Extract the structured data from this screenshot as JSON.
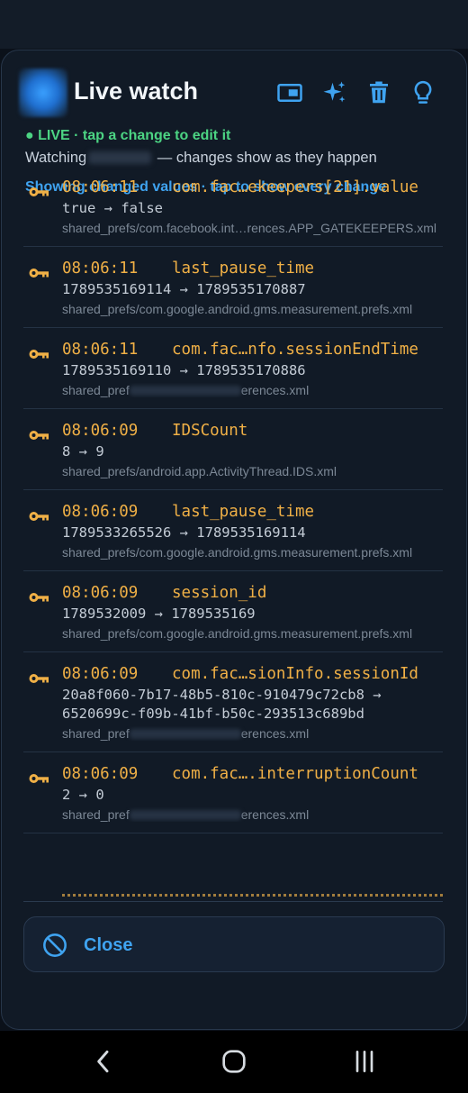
{
  "header": {
    "title": "Live watch",
    "icons": [
      "picture-in-picture-icon",
      "sparkles-icon",
      "trash-icon",
      "lightbulb-icon"
    ]
  },
  "status": "● LIVE · tap a change to edit it",
  "watching": {
    "prefix": "Watching",
    "suffix": "— changes show as they happen"
  },
  "filter_label": "Showing changed values · tap to show every change",
  "changes": [
    {
      "time": "08:06:11",
      "key": "com.fac…ekeepers[21].value",
      "change": "true → false",
      "path": "shared_prefs/com.facebook.int…rences.APP_GATEKEEPERS.xml"
    },
    {
      "time": "08:06:11",
      "key": "last_pause_time",
      "change": "1789535169114 → 1789535170887",
      "path": "shared_prefs/com.google.android.gms.measurement.prefs.xml"
    },
    {
      "time": "08:06:11",
      "key": "com.fac…nfo.sessionEndTime",
      "change": "1789535169110 → 1789535170886",
      "path_start": "shared_pref",
      "path_end": "erences.xml"
    },
    {
      "time": "08:06:09",
      "key": "IDSCount",
      "change": "8 → 9",
      "path": "shared_prefs/android.app.ActivityThread.IDS.xml"
    },
    {
      "time": "08:06:09",
      "key": "last_pause_time",
      "change": "1789533265526 → 1789535169114",
      "path": "shared_prefs/com.google.android.gms.measurement.prefs.xml"
    },
    {
      "time": "08:06:09",
      "key": "session_id",
      "change": "1789532009 → 1789535169",
      "path": "shared_prefs/com.google.android.gms.measurement.prefs.xml"
    },
    {
      "time": "08:06:09",
      "key": "com.fac…sionInfo.sessionId",
      "change": "20a8f060-7b17-48b5-810c-910479c72cb8 → 6520699c-f09b-41bf-b50c-293513c689bd",
      "path_start": "shared_pref",
      "path_end": "erences.xml"
    },
    {
      "time": "08:06:09",
      "key": "com.fac….interruptionCount",
      "change": "2 → 0",
      "path_start": "shared_pref",
      "path_end": "erences.xml"
    }
  ],
  "close_label": "Close",
  "colors": {
    "accent": "#3fa3f0",
    "live": "#4cd483",
    "key": "#f0b046",
    "background": "#111a26"
  }
}
